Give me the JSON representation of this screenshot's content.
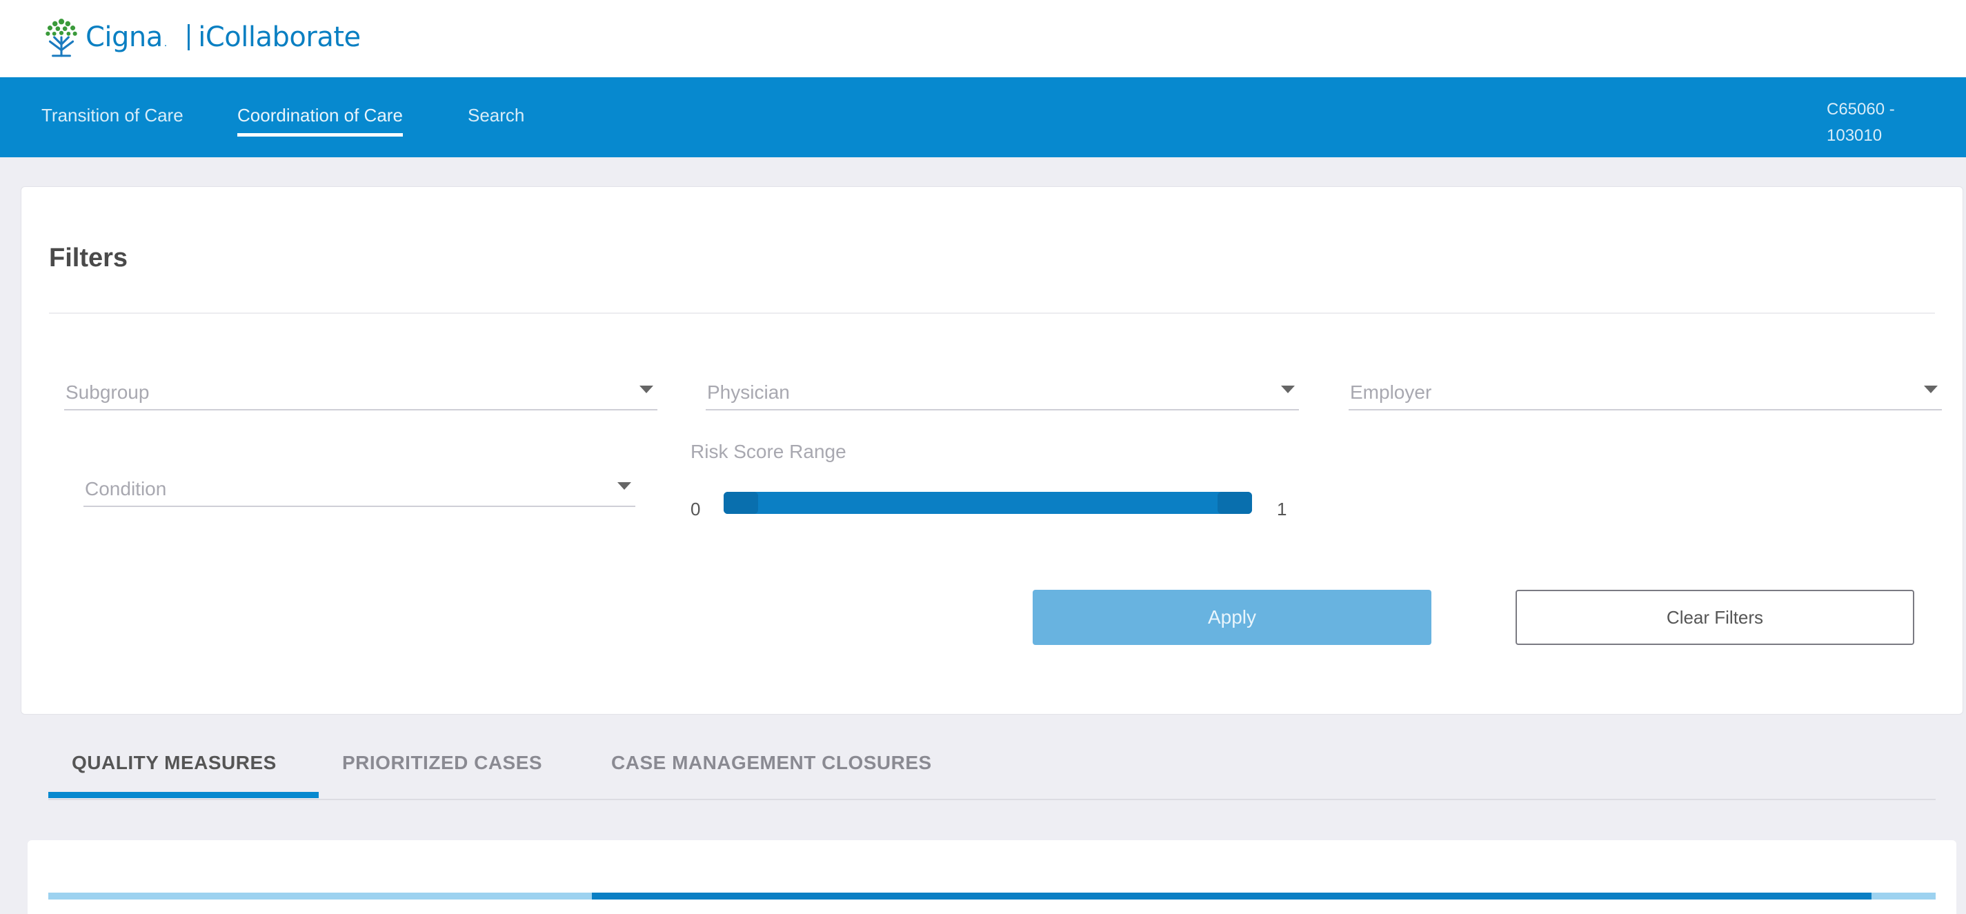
{
  "header": {
    "brand": "Cigna",
    "brand_mark": ".",
    "app_name": "iCollaborate"
  },
  "nav": {
    "items": [
      {
        "label": "Transition of Care",
        "active": false
      },
      {
        "label": "Coordination of Care",
        "active": true
      },
      {
        "label": "Search",
        "active": false
      }
    ],
    "user_line1": "C65060 -",
    "user_line2": "103010"
  },
  "filters": {
    "title": "Filters",
    "subgroup_placeholder": "Subgroup",
    "physician_placeholder": "Physician",
    "employer_placeholder": "Employer",
    "condition_placeholder": "Condition",
    "risk_label": "Risk Score Range",
    "risk_min": "0",
    "risk_max": "1",
    "apply_label": "Apply",
    "clear_label": "Clear Filters"
  },
  "tabs": [
    {
      "label": "QUALITY MEASURES",
      "active": true
    },
    {
      "label": "PRIORITIZED CASES",
      "active": false
    },
    {
      "label": "CASE MANAGEMENT CLOSURES",
      "active": false
    }
  ],
  "loading": {
    "fill_start": 0.288,
    "fill_end": 0.966
  },
  "colors": {
    "brand_blue": "#0789cf",
    "apply_button": "#68b3e0"
  }
}
